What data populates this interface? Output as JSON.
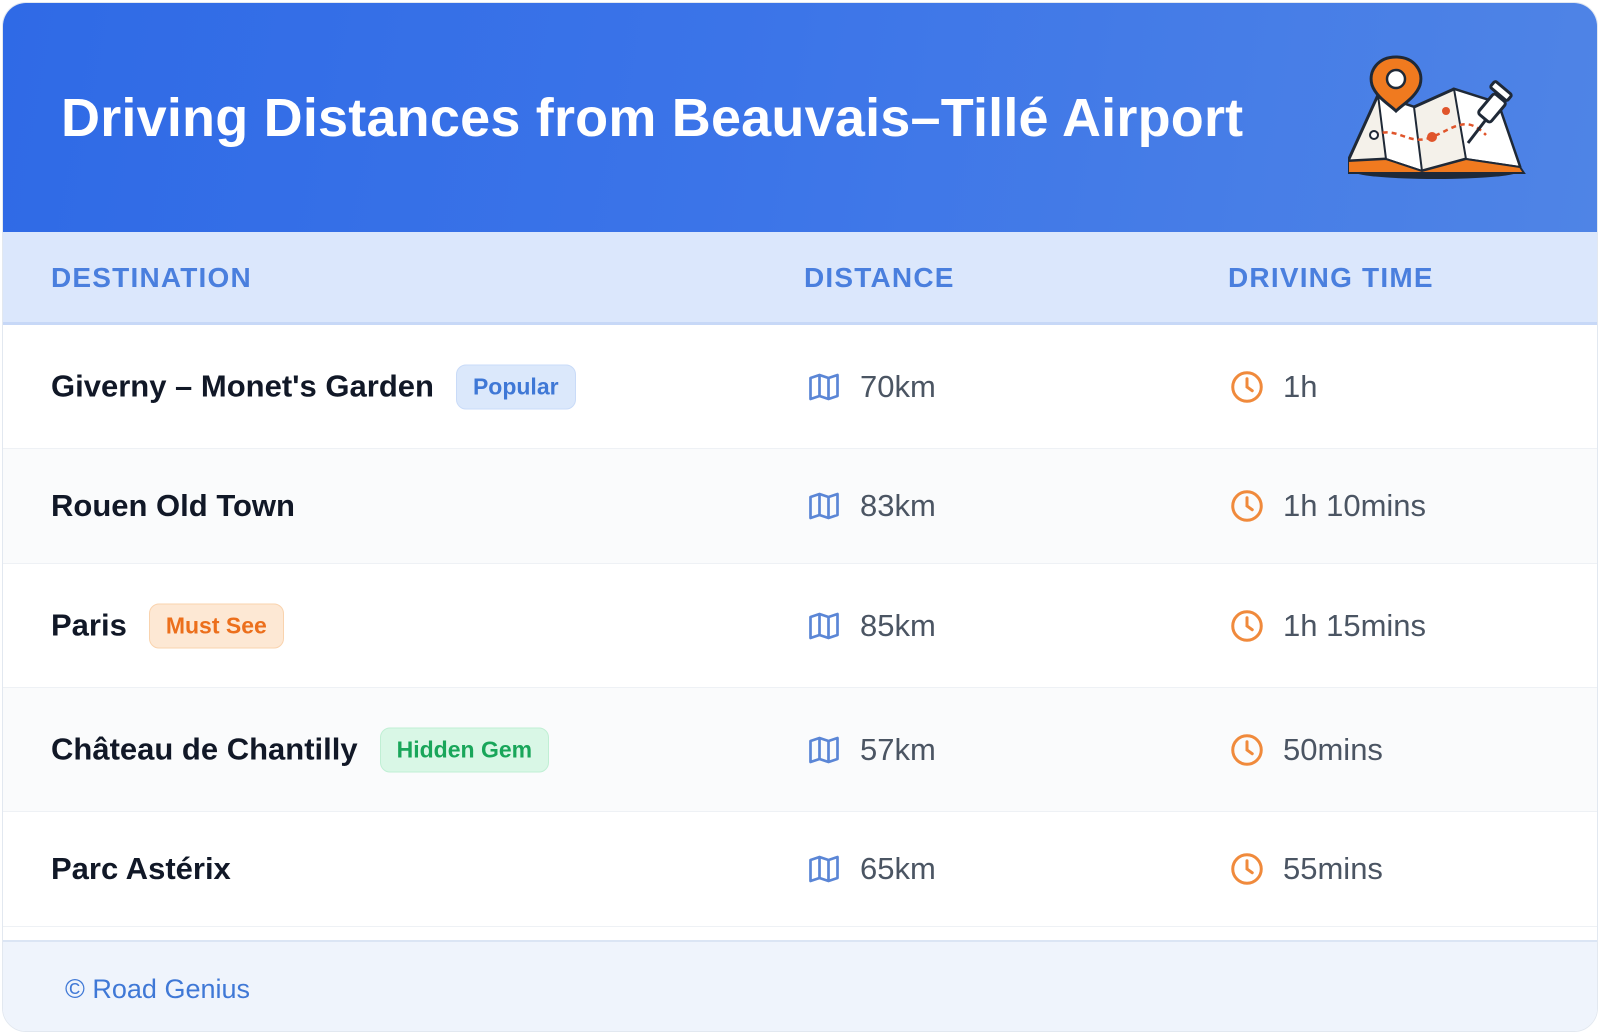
{
  "header": {
    "title": "Driving Distances from Beauvais–Tillé Airport",
    "illustration": "map-with-pins-icon"
  },
  "table": {
    "columns": [
      "DESTINATION",
      "DISTANCE",
      "DRIVING TIME"
    ],
    "rows": [
      {
        "destination": "Giverny – Monet's Garden",
        "badge": "Popular",
        "badge_color": "#3f78d6",
        "distance": "70km",
        "time": "1h"
      },
      {
        "destination": "Rouen Old Town",
        "badge": "",
        "distance": "83km",
        "time": "1h 10mins"
      },
      {
        "destination": "Paris",
        "badge": "Must See",
        "badge_color": "#ec6f1c",
        "distance": "85km",
        "time": "1h 15mins"
      },
      {
        "destination": "Château de Chantilly",
        "badge": "Hidden Gem",
        "badge_color": "#19a65a",
        "distance": "57km",
        "time": "50mins"
      },
      {
        "destination": "Parc Astérix",
        "badge": "",
        "distance": "65km",
        "time": "55mins"
      }
    ],
    "icons": {
      "distance": "map-icon",
      "time": "clock-icon"
    }
  },
  "footer": {
    "text": "© Road Genius"
  },
  "colors": {
    "header": "#2f6ae6",
    "accent": "#4a7fde",
    "clock": "#f08a3c",
    "map": "#5b86d6"
  }
}
